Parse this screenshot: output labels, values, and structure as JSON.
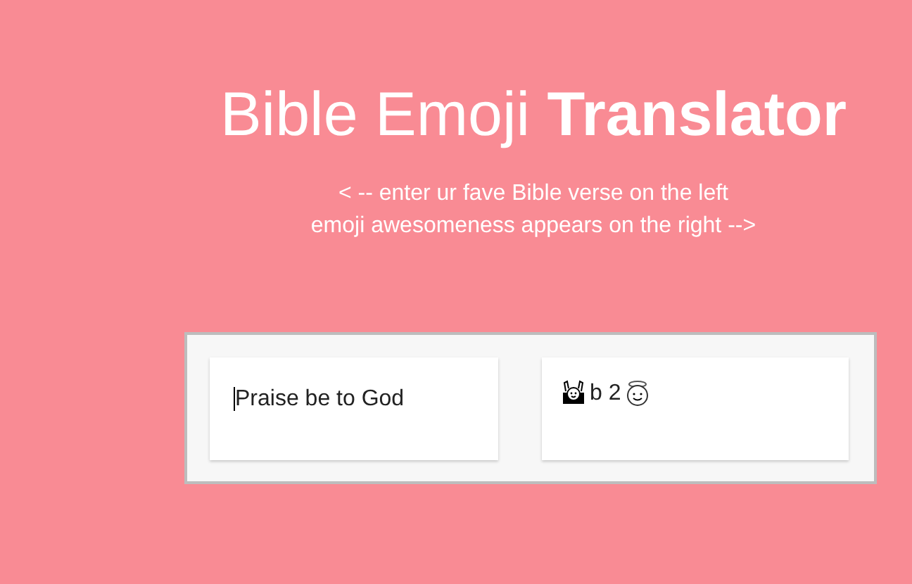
{
  "title": {
    "light": "Bible Emoji",
    "bold": "Translator"
  },
  "subtitle_lines": [
    "< -- enter ur fave Bible verse on the left",
    "emoji awesomeness appears on the right -->"
  ],
  "input": {
    "value": "Praise be to God"
  },
  "output": {
    "parts": [
      {
        "kind": "hands"
      },
      {
        "kind": "text",
        "text": "b 2"
      },
      {
        "kind": "halo"
      }
    ]
  }
}
